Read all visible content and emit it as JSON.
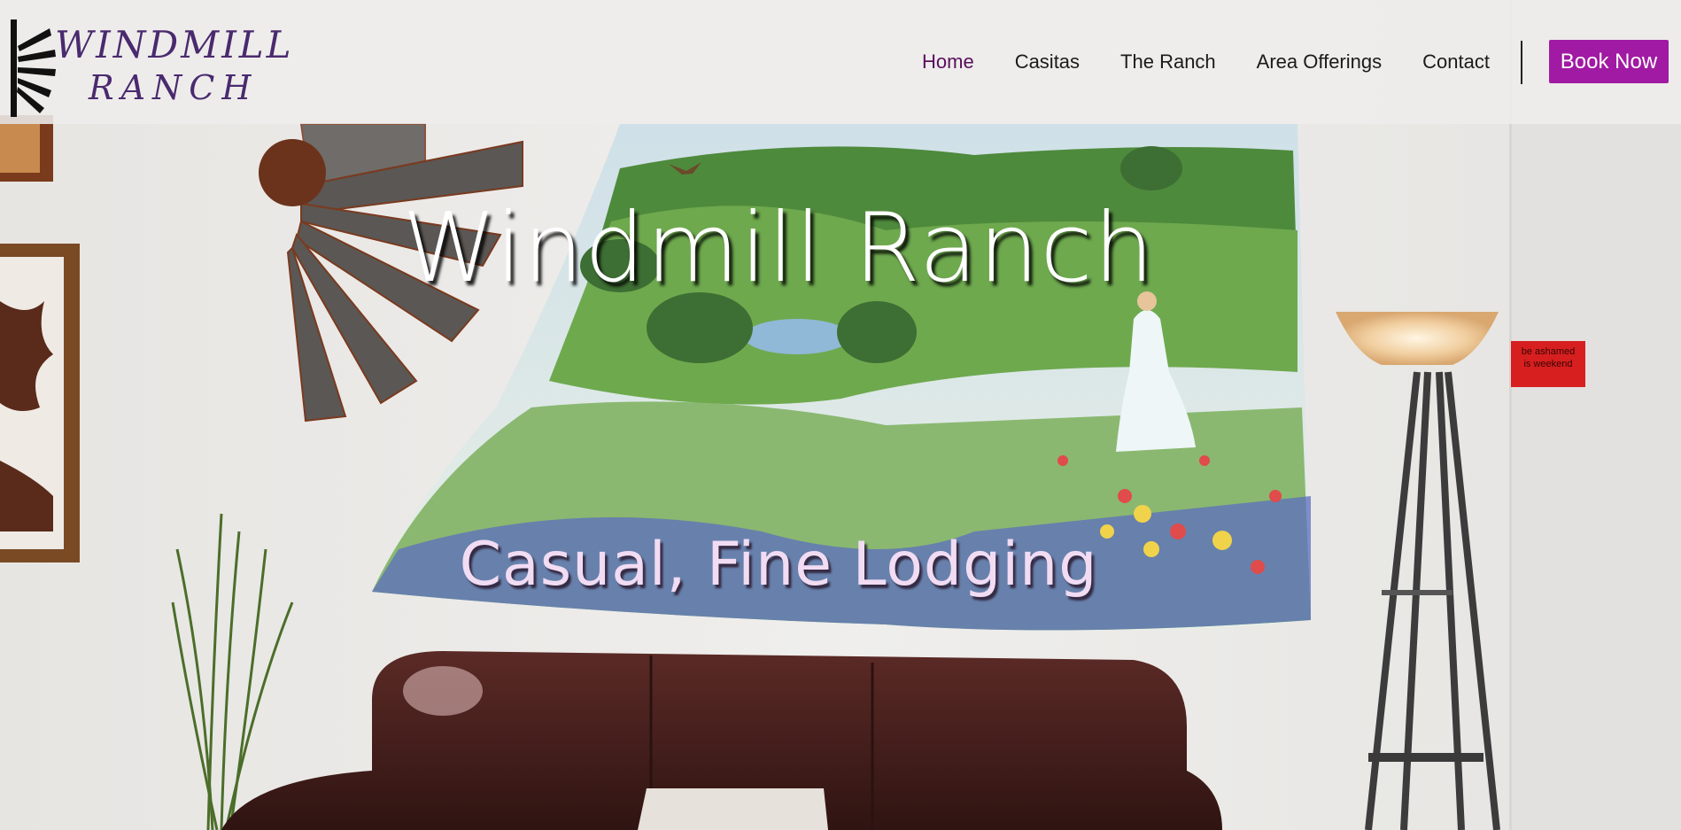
{
  "site": {
    "logo": {
      "line1": "WINDMILL",
      "line2": "RANCH"
    }
  },
  "nav": {
    "items": [
      {
        "label": "Home",
        "active": true
      },
      {
        "label": "Casitas",
        "active": false
      },
      {
        "label": "The Ranch",
        "active": false
      },
      {
        "label": "Area Offerings",
        "active": false
      },
      {
        "label": "Contact",
        "active": false
      }
    ],
    "book_label": "Book Now"
  },
  "hero": {
    "title": "Windmill Ranch",
    "subtitle": "Casual, Fine Lodging",
    "sign": {
      "line1": "be ashamed",
      "line2": "is weekend"
    }
  },
  "colors": {
    "accent": "#a11aa3",
    "nav_active": "#5a0f5c",
    "logo": "#4a2a6e"
  }
}
